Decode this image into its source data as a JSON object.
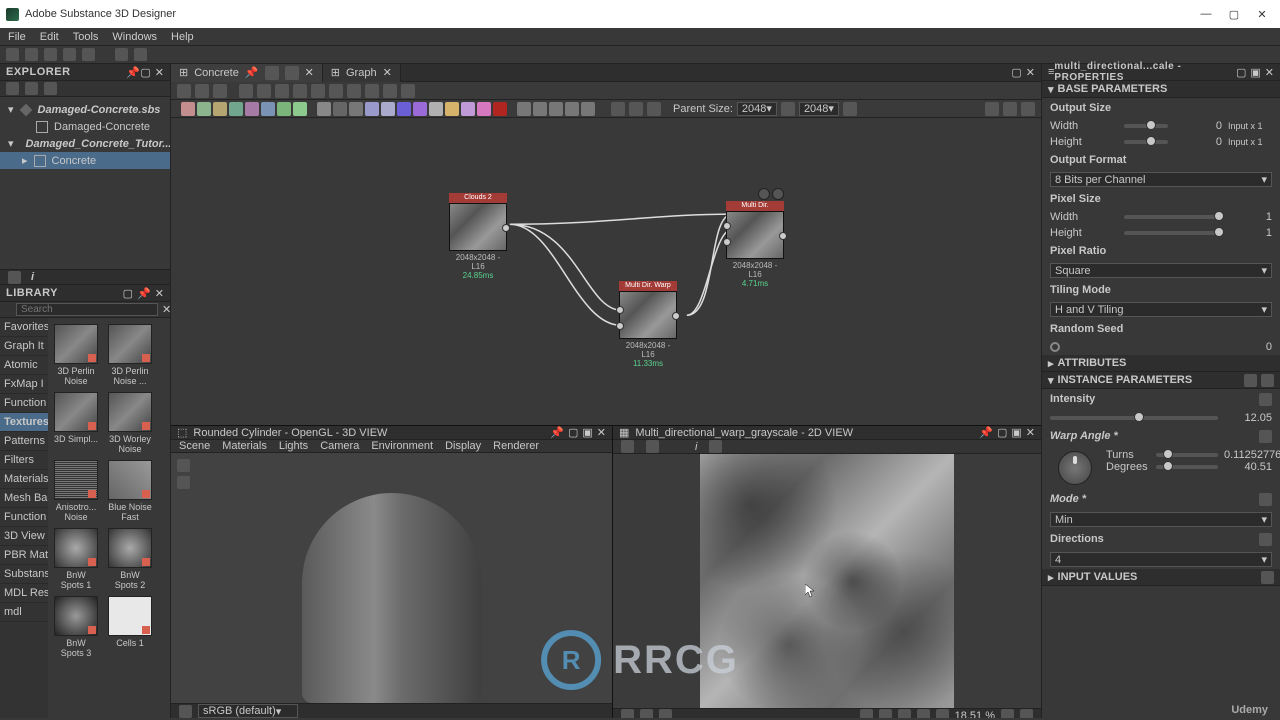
{
  "app": {
    "title": "Adobe Substance 3D Designer"
  },
  "menu": [
    "File",
    "Edit",
    "Tools",
    "Windows",
    "Help"
  ],
  "explorer": {
    "title": "EXPLORER",
    "items": [
      {
        "label": "Damaged-Concrete.sbs",
        "bold": true
      },
      {
        "label": "Damaged-Concrete"
      },
      {
        "label": "Damaged_Concrete_Tutor...",
        "bold": true
      },
      {
        "label": "Concrete",
        "selected": true
      }
    ]
  },
  "library": {
    "title": "LIBRARY",
    "search_placeholder": "Search",
    "cats": [
      "Favorites",
      "Graph It",
      "Atomic",
      "FxMap I",
      "Function",
      "Textures",
      "Patterns",
      "Filters",
      "Materials",
      "Mesh Ba",
      "Function",
      "3D View",
      "PBR Mat",
      "Substans",
      "MDL Res",
      "mdl"
    ],
    "thumbs": [
      [
        "3D Perlin Noise",
        "3D Perlin Noise ..."
      ],
      [
        "3D Simpl...",
        "3D Worley Noise"
      ],
      [
        "Anisotro... Noise",
        "Blue Noise Fast"
      ],
      [
        "BnW Spots 1",
        "BnW Spots 2"
      ],
      [
        "BnW Spots 3",
        "Cells 1"
      ]
    ]
  },
  "graph": {
    "tabs": [
      {
        "label": "Concrete",
        "active": true
      },
      {
        "label": "Graph",
        "active": false
      }
    ],
    "parent_label": "Parent Size:",
    "sizeA": "2048",
    "sizeB": "2048",
    "nodes": {
      "a": {
        "title": "Clouds 2",
        "meta": "2048x2048 - L16",
        "time": "24.85ms"
      },
      "b": {
        "title": "Multi Dir. Warp Grayscale",
        "meta": "2048x2048 - L16",
        "time": "11.33ms"
      },
      "c": {
        "title": "Multi Dir. WarpGrayscal",
        "meta": "2048x2048 - L16",
        "time": "4.71ms"
      }
    }
  },
  "view3d": {
    "title": "Rounded Cylinder - OpenGL - 3D VIEW",
    "menu": [
      "Scene",
      "Materials",
      "Lights",
      "Camera",
      "Environment",
      "Display",
      "Renderer"
    ],
    "colorspace": "sRGB (default)"
  },
  "view2d": {
    "title": "Multi_directional_warp_grayscale - 2D VIEW",
    "zoom": "18.51 %"
  },
  "properties": {
    "title": "multi_directional...cale - PROPERTIES",
    "sections": {
      "base": "BASE PARAMETERS",
      "attrs": "ATTRIBUTES",
      "inst": "INSTANCE PARAMETERS",
      "input": "INPUT VALUES"
    },
    "base": {
      "output_size": "Output Size",
      "width": "Width",
      "width_val": "0",
      "width_extra": "Input x 1",
      "height": "Height",
      "height_val": "0",
      "height_extra": "Input x 1",
      "output_format": "Output Format",
      "format_val": "8 Bits per Channel",
      "pixel_size": "Pixel Size",
      "ps_width": "Width",
      "ps_width_val": "1",
      "ps_height": "Height",
      "ps_height_val": "1",
      "pixel_ratio": "Pixel Ratio",
      "ratio_val": "Square",
      "tiling": "Tiling Mode",
      "tiling_val": "H and V Tiling",
      "random_seed": "Random Seed",
      "seed_val": "0"
    },
    "instance": {
      "intensity": "Intensity",
      "intensity_val": "12.05",
      "warp_angle": "Warp Angle *",
      "turns": "Turns",
      "turns_val": "0.11252776",
      "degrees": "Degrees",
      "degrees_val": "40.51",
      "mode": "Mode *",
      "mode_val": "Min",
      "directions": "Directions",
      "directions_val": "4"
    }
  },
  "watermark": {
    "txt": "RRCG"
  },
  "udemy": "Udemy"
}
